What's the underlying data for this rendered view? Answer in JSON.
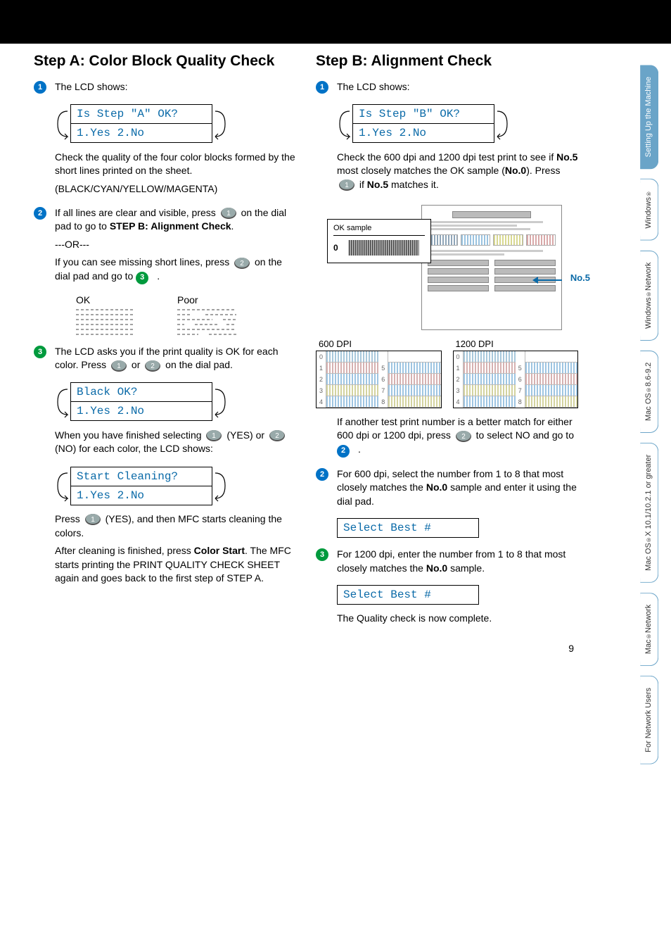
{
  "page_number": "9",
  "side_tabs": [
    {
      "label": "Setting Up the Machine",
      "active": true
    },
    {
      "label": "Windows®",
      "active": false
    },
    {
      "label": "Windows® Network",
      "active": false
    },
    {
      "label": "Mac OS® 8.6-9.2",
      "active": false
    },
    {
      "label": "Mac OS® X 10.1/10.2.1 or greater",
      "active": false
    },
    {
      "label": "Mac® Network",
      "active": false
    },
    {
      "label": "For Network Users",
      "active": false
    }
  ],
  "step_a": {
    "title": "Step A:  Color Block Quality Check",
    "s1": {
      "intro": "The LCD shows:",
      "lcd": {
        "line1": "Is Step \"A\" OK?",
        "line2": "1.Yes 2.No"
      },
      "body": "Check the quality of the four color blocks formed by the short lines printed on the sheet.",
      "body2": "(BLACK/CYAN/YELLOW/MAGENTA)"
    },
    "s2": {
      "line1a": "If all lines are clear and visible, press ",
      "line1b": " on the dial pad to go to ",
      "bold1": "STEP B: Alignment Check",
      "dot": ".",
      "or": "---OR---",
      "line2a": "If you can see missing short lines, press ",
      "line2b": " on the dial pad and go to ",
      "dot2": ".",
      "ok_label": "OK",
      "poor_label": "Poor"
    },
    "s3": {
      "line1a": "The LCD asks you if the print quality is OK for each color. Press ",
      "line1b": " or ",
      "line1c": " on the dial pad.",
      "lcd": {
        "line1": "Black OK?",
        "line2": "1.Yes 2.No"
      },
      "line2a": "When you have finished selecting ",
      "line2b": " (YES) or ",
      "line2c": " (NO) for each color, the LCD shows:",
      "lcd2": {
        "line1": "Start Cleaning?",
        "line2": "1.Yes 2.No"
      },
      "line3a": "Press ",
      "line3b": " (YES), and then MFC starts cleaning the colors.",
      "line4a": "After cleaning is finished, press ",
      "bold4": "Color Start",
      "line4b": ". The MFC starts printing the PRINT QUALITY CHECK SHEET again and goes back to the first step of STEP A."
    }
  },
  "step_b": {
    "title": "Step B:  Alignment Check",
    "s1": {
      "intro": "The LCD shows:",
      "lcd": {
        "line1": "Is Step \"B\" OK?",
        "line2": "1.Yes 2.No"
      },
      "line1a": "Check the 600 dpi and 1200 dpi test print to see if ",
      "bold1": "No.5",
      "line1b": " most closely matches the OK sample (",
      "bold2": "No.0",
      "line1c": "). Press ",
      "line1d": " if ",
      "bold3": "No.5",
      "line1e": " matches it.",
      "ok_sample": "OK sample",
      "zero": "0",
      "no5": "No.5",
      "dpi600": "600 DPI",
      "dpi1200": "1200 DPI",
      "line2a": "If another test print number is a better match for either 600 dpi or 1200 dpi, press ",
      "line2b": " to select NO and go to ",
      "dot2": "."
    },
    "s2": {
      "line1a": "For 600 dpi, select the number from 1 to 8 that most closely matches the ",
      "bold1": "No.0",
      "line1b": " sample and enter it using the dial pad.",
      "lcd": {
        "line1": "Select Best #"
      }
    },
    "s3": {
      "line1a": "For 1200 dpi, enter the number from 1 to 8 that most closely matches the ",
      "bold1": "No.0",
      "line1b": " sample.",
      "lcd": {
        "line1": "Select Best #"
      },
      "final": "The Quality check is now complete."
    }
  }
}
